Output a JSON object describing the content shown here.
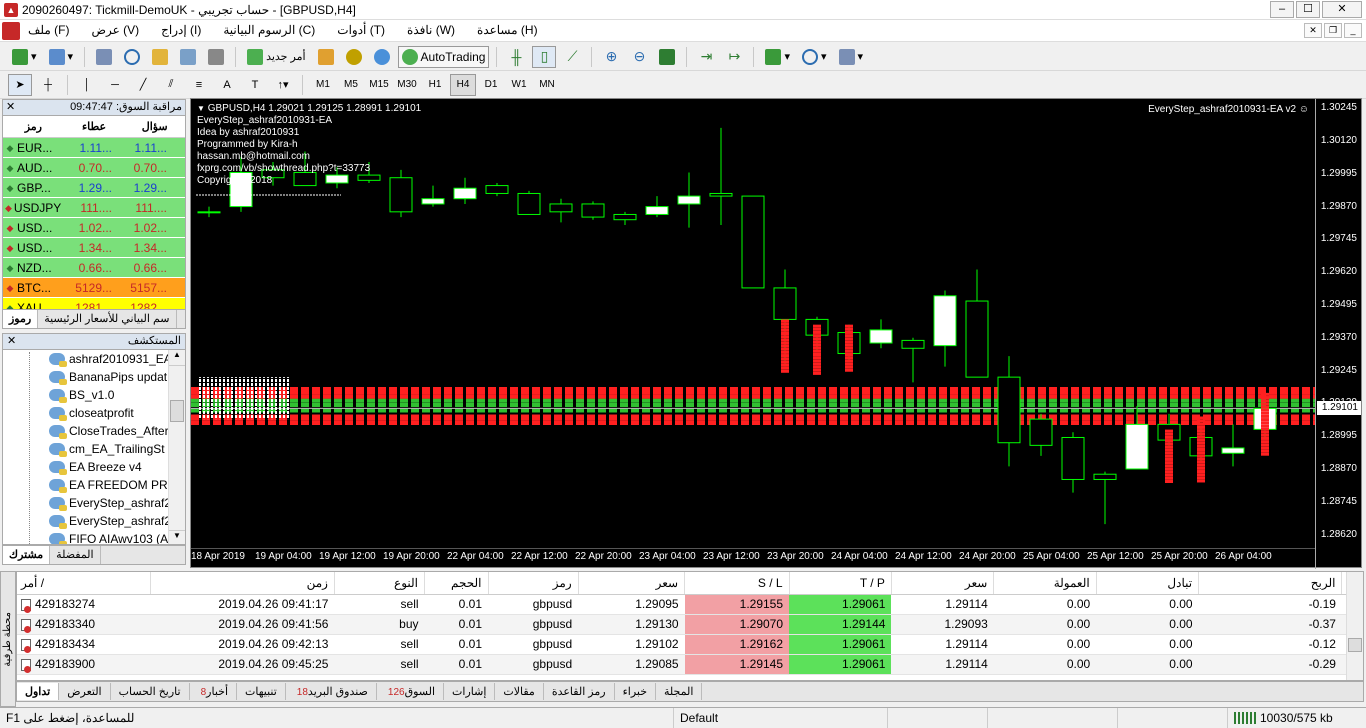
{
  "window": {
    "title": "2090260497: Tickmill-DemoUK - حساب تجريبي - [GBPUSD,H4]",
    "min": "‒",
    "max": "☐",
    "close": "✕"
  },
  "menu": {
    "items": [
      "ملف (F)",
      "عرض (V)",
      "إدراج (I)",
      "الرسوم البيانية (C)",
      "أدوات (T)",
      "نافذة (W)",
      "مساعدة (H)"
    ]
  },
  "toolbar": {
    "new_order": "أمر جديد",
    "autotrading": "AutoTrading",
    "timeframes": [
      "M1",
      "M5",
      "M15",
      "M30",
      "H1",
      "H4",
      "D1",
      "W1",
      "MN"
    ],
    "active_timeframe": "H4"
  },
  "market_watch": {
    "title": "مراقبة السوق: 09:47:47",
    "col_symbol": "رمز",
    "col_bid": "عطاء",
    "col_ask": "سؤال",
    "rows": [
      {
        "symbol": "EUR...",
        "bid": "1.11...",
        "ask": "1.11...",
        "color": "blue",
        "dir": "up"
      },
      {
        "symbol": "AUD...",
        "bid": "0.70...",
        "ask": "0.70...",
        "color": "red",
        "dir": "up"
      },
      {
        "symbol": "GBP...",
        "bid": "1.29...",
        "ask": "1.29...",
        "color": "blue",
        "dir": "up"
      },
      {
        "symbol": "USDJPY",
        "bid": "111....",
        "ask": "111....",
        "color": "red",
        "dir": "down"
      },
      {
        "symbol": "USD...",
        "bid": "1.02...",
        "ask": "1.02...",
        "color": "red",
        "dir": "down"
      },
      {
        "symbol": "USD...",
        "bid": "1.34...",
        "ask": "1.34...",
        "color": "red",
        "dir": "down"
      },
      {
        "symbol": "NZD...",
        "bid": "0.66...",
        "ask": "0.66...",
        "color": "red",
        "dir": "up"
      },
      {
        "symbol": "BTC...",
        "bid": "5129...",
        "ask": "5157...",
        "color": "orange",
        "dir": "down"
      },
      {
        "symbol": "XAU...",
        "bid": "1281...",
        "ask": "1282...",
        "color": "yellow",
        "dir": "up"
      }
    ],
    "tab_symbols": "رموز",
    "tab_chart": "سم البياني للأسعار الرئيسية"
  },
  "navigator": {
    "title": "المستكشف",
    "items": [
      "ashraf2010931_EA",
      "BananaPips updat",
      "BS_v1.0",
      "closeatprofit",
      "CloseTrades_After",
      "cm_EA_TrailingSt",
      "EA Breeze v4",
      "EA FREEDOM PRC",
      "EveryStep_ashraf2",
      "EveryStep_ashraf2",
      "FIFO AIAwv103 (A"
    ],
    "tab_common": "مشترك",
    "tab_favorites": "المفضلة"
  },
  "chart": {
    "header": "GBPUSD,H4  1.29021 1.29125 1.28991 1.29101",
    "info_lines": [
      "EveryStep_ashraf2010931-EA",
      "Idea by ashraf2010931",
      "Programmed by Kira-h",
      "hassan.mb@hotmail.com",
      "fxprg.com/vb/showthread.php?t=33773",
      "Copyright ©2018"
    ],
    "ea_label": "EveryStep_ashraf2010931-EA v2 ☺",
    "current_price": "1.29101",
    "price_ticks": [
      "1.30245",
      "1.30120",
      "1.29995",
      "1.29870",
      "1.29745",
      "1.29620",
      "1.29495",
      "1.29370",
      "1.29245",
      "1.29120",
      "1.28995",
      "1.28870",
      "1.28745",
      "1.28620"
    ],
    "time_ticks": [
      "18 Apr 2019",
      "19 Apr 04:00",
      "19 Apr 12:00",
      "19 Apr 20:00",
      "22 Apr 04:00",
      "22 Apr 12:00",
      "22 Apr 20:00",
      "23 Apr 04:00",
      "23 Apr 12:00",
      "23 Apr 20:00",
      "24 Apr 04:00",
      "24 Apr 12:00",
      "24 Apr 20:00",
      "25 Apr 04:00",
      "25 Apr 12:00",
      "25 Apr 20:00",
      "26 Apr 04:00"
    ],
    "candles": [
      {
        "o": 1.2985,
        "c": 1.2985,
        "h": 1.2987,
        "l": 1.2983
      },
      {
        "o": 1.2987,
        "c": 1.3,
        "h": 1.3006,
        "l": 1.2985
      },
      {
        "o": 1.3001,
        "c": 1.2998,
        "h": 1.3004,
        "l": 1.2995
      },
      {
        "o": 1.3,
        "c": 1.2995,
        "h": 1.3008,
        "l": 1.2995
      },
      {
        "o": 1.2996,
        "c": 1.2999,
        "h": 1.3002,
        "l": 1.2994
      },
      {
        "o": 1.2999,
        "c": 1.2997,
        "h": 1.3004,
        "l": 1.2996
      },
      {
        "o": 1.2998,
        "c": 1.2985,
        "h": 1.3001,
        "l": 1.2983
      },
      {
        "o": 1.2988,
        "c": 1.299,
        "h": 1.2995,
        "l": 1.2987
      },
      {
        "o": 1.299,
        "c": 1.2994,
        "h": 1.2998,
        "l": 1.2988
      },
      {
        "o": 1.2995,
        "c": 1.2992,
        "h": 1.2996,
        "l": 1.2991
      },
      {
        "o": 1.2992,
        "c": 1.2984,
        "h": 1.2993,
        "l": 1.2984
      },
      {
        "o": 1.2988,
        "c": 1.2985,
        "h": 1.299,
        "l": 1.2981
      },
      {
        "o": 1.2988,
        "c": 1.2983,
        "h": 1.2989,
        "l": 1.2982
      },
      {
        "o": 1.2984,
        "c": 1.2982,
        "h": 1.2985,
        "l": 1.298
      },
      {
        "o": 1.2984,
        "c": 1.2987,
        "h": 1.2991,
        "l": 1.2983
      },
      {
        "o": 1.2988,
        "c": 1.2991,
        "h": 1.3,
        "l": 1.2979
      },
      {
        "o": 1.2992,
        "c": 1.2991,
        "h": 1.3017,
        "l": 1.298
      },
      {
        "o": 1.2991,
        "c": 1.2956,
        "h": 1.2991,
        "l": 1.2956
      },
      {
        "o": 1.2956,
        "c": 1.2944,
        "h": 1.2963,
        "l": 1.2926
      },
      {
        "o": 1.2944,
        "c": 1.2938,
        "h": 1.2945,
        "l": 1.2932
      },
      {
        "o": 1.2939,
        "c": 1.2931,
        "h": 1.2942,
        "l": 1.2928
      },
      {
        "o": 1.2935,
        "c": 1.294,
        "h": 1.2944,
        "l": 1.2933
      },
      {
        "o": 1.2936,
        "c": 1.2933,
        "h": 1.2937,
        "l": 1.292
      },
      {
        "o": 1.2934,
        "c": 1.2953,
        "h": 1.2955,
        "l": 1.2926
      },
      {
        "o": 1.2951,
        "c": 1.2922,
        "h": 1.2963,
        "l": 1.2922
      },
      {
        "o": 1.2922,
        "c": 1.2897,
        "h": 1.293,
        "l": 1.2888
      },
      {
        "o": 1.2906,
        "c": 1.2896,
        "h": 1.2908,
        "l": 1.2892
      },
      {
        "o": 1.2899,
        "c": 1.2883,
        "h": 1.2901,
        "l": 1.2878
      },
      {
        "o": 1.2885,
        "c": 1.2883,
        "h": 1.2886,
        "l": 1.2866
      },
      {
        "o": 1.2887,
        "c": 1.2904,
        "h": 1.2911,
        "l": 1.2887
      },
      {
        "o": 1.2904,
        "c": 1.2898,
        "h": 1.2908,
        "l": 1.2896
      },
      {
        "o": 1.2899,
        "c": 1.2892,
        "h": 1.2903,
        "l": 1.289
      },
      {
        "o": 1.2893,
        "c": 1.2895,
        "h": 1.2904,
        "l": 1.2888
      },
      {
        "o": 1.29021,
        "c": 1.29101,
        "h": 1.29125,
        "l": 1.28991
      }
    ]
  },
  "terminal": {
    "side_label": "محطة طرفية",
    "headers": [
      "أمر  /",
      "زمن",
      "النوع",
      "الحجم",
      "رمز",
      "سعر",
      "S / L",
      "T / P",
      "سعر",
      "العمولة",
      "تبادل",
      "الربح",
      ""
    ],
    "rows": [
      [
        "429183274",
        "2019.04.26 09:41:17",
        "sell",
        "0.01",
        "gbpusd",
        "1.29095",
        "1.29155",
        "1.29061",
        "1.29114",
        "0.00",
        "0.00",
        "-0.19",
        "×"
      ],
      [
        "429183340",
        "2019.04.26 09:41:56",
        "buy",
        "0.01",
        "gbpusd",
        "1.29130",
        "1.29070",
        "1.29144",
        "1.29093",
        "0.00",
        "0.00",
        "-0.37",
        "×"
      ],
      [
        "429183434",
        "2019.04.26 09:42:13",
        "sell",
        "0.01",
        "gbpusd",
        "1.29102",
        "1.29162",
        "1.29061",
        "1.29114",
        "0.00",
        "0.00",
        "-0.12",
        "×"
      ],
      [
        "429183900",
        "2019.04.26 09:45:25",
        "sell",
        "0.01",
        "gbpusd",
        "1.29085",
        "1.29145",
        "1.29061",
        "1.29114",
        "0.00",
        "0.00",
        "-0.29",
        "×"
      ]
    ],
    "tabs": [
      {
        "label": "تداول",
        "badge": ""
      },
      {
        "label": "التعرض",
        "badge": ""
      },
      {
        "label": "تاريخ الحساب",
        "badge": ""
      },
      {
        "label": "أخبار",
        "badge": "8"
      },
      {
        "label": "تنبيهات",
        "badge": ""
      },
      {
        "label": "صندوق البريد",
        "badge": "18"
      },
      {
        "label": "السوق",
        "badge": "126"
      },
      {
        "label": "إشارات",
        "badge": ""
      },
      {
        "label": "مقالات",
        "badge": ""
      },
      {
        "label": "رمز القاعدة",
        "badge": ""
      },
      {
        "label": "خبراء",
        "badge": ""
      },
      {
        "label": "المجلة",
        "badge": ""
      }
    ]
  },
  "status": {
    "help": "للمساعدة، إضغط على F1",
    "profile": "Default",
    "traffic": "10030/575 kb"
  },
  "colors": {
    "bull_candle": "#ffffff",
    "bear_candle": "#000000",
    "wick": "#00ff00",
    "tp_green": "#5ce15a",
    "sl_red": "#f2a0a4"
  }
}
